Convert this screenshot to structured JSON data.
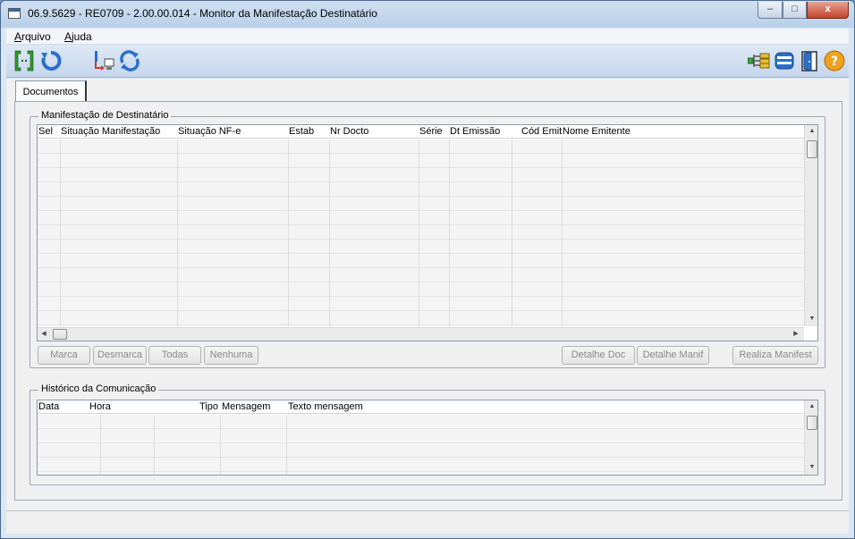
{
  "window": {
    "title": "06.9.5629 - RE0709 - 2.00.00.014 - Monitor da Manifestação Destinatário",
    "controls": {
      "minimize": "–",
      "maximize": "□",
      "close": "x"
    }
  },
  "menu": [
    {
      "label": "Arquivo",
      "accel": "A",
      "rest": "rquivo"
    },
    {
      "label": "Ajuda",
      "accel": "A",
      "rest": "juda"
    }
  ],
  "toolbar": {
    "left": [
      "bracket-select-icon",
      "refresh-icon",
      "transfer-computer-icon",
      "sync-icon"
    ],
    "right": [
      "tree-icon",
      "print-icon",
      "exit-door-icon",
      "help-icon"
    ]
  },
  "tabs": [
    {
      "label": "Documentos"
    }
  ],
  "manifestacao": {
    "title": "Manifestação de Destinatário",
    "columns": [
      "Sel",
      "Situação Manifestação",
      "Situação NF-e",
      "Estab",
      "Nr Docto",
      "Série",
      "Dt Emissão",
      "Cód Emit",
      "Nome Emitente"
    ],
    "buttons": {
      "marca": "Marca",
      "desmarca": "Desmarca",
      "todas": "Todas",
      "nenhuma": "Nenhuma",
      "detalhe_doc": "Detalhe Doc",
      "detalhe_manif": "Detalhe Manif",
      "realiza_manifest": "Realiza Manifest"
    }
  },
  "historico": {
    "title": "Histórico da Comunicação",
    "columns": [
      "Data",
      "Hora",
      "Tipo",
      "Mensagem",
      "Texto mensagem"
    ]
  },
  "colors": {
    "titlebar": "#c4d7ec",
    "toolbar": "#d2e0f0",
    "panel": "#f0f0f0",
    "disabled_text": "#8a8a8a",
    "close_button": "#c5422b"
  }
}
